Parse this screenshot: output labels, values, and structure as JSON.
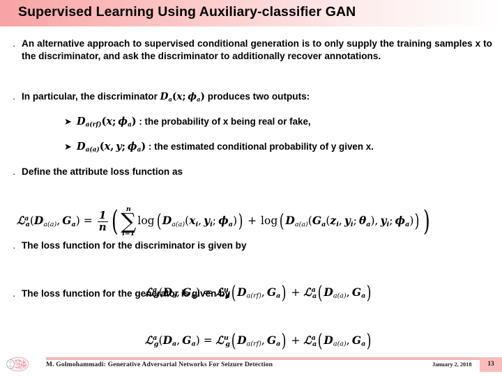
{
  "slide": {
    "title": "Supervised Learning Using Auxiliary-classifier GAN",
    "title_gradient_from": "#f8a3a3",
    "title_gradient_to": "#ffffff"
  },
  "bullets": [
    {
      "marker": "·",
      "text": "An alternative approach to supervised conditional generation is to only supply the training samples x to the discriminator, and ask the discriminator to additionally recover annotations."
    },
    {
      "marker": "·",
      "text_prefix": "In particular, the discriminator ",
      "text_suffix": " produces two outputs:"
    },
    {
      "marker": "·",
      "text": "Define the attribute loss function as"
    },
    {
      "marker": "·",
      "text": "The loss function for the discriminator is given by"
    },
    {
      "marker": "·",
      "text": "The loss function for the generator is given by"
    }
  ],
  "sub_bullets": [
    {
      "marker": "➤",
      "description": ": the probability of x being real or fake,"
    },
    {
      "marker": "➤",
      "description": ": the estimated conditional probability of y given x."
    }
  ],
  "math": {
    "D": "D",
    "G": "G",
    "L": "ℒ",
    "a": "a",
    "a_rf": "a(rf)",
    "a_a": "a(a)",
    "x": "x",
    "y": "y",
    "z": "z",
    "n": "n",
    "i": "i",
    "phi_a": "ϕ",
    "theta_a": "θ",
    "sum": "∑",
    "log": "log",
    "equals": "=",
    "plus": "+",
    "one": "1",
    "lower_limit": "i=1",
    "sup_u": "u",
    "sup_a": "a",
    "sub_d": "d",
    "sub_g": "g"
  },
  "footer": {
    "citation": "M. Golmohammadi: Generative Adversarial Networks For Seizure Detection",
    "date": "January 2, 2018",
    "page_number": "13",
    "rule_color": "#f2b8b8",
    "page_box_color": "#f9bcbc"
  }
}
